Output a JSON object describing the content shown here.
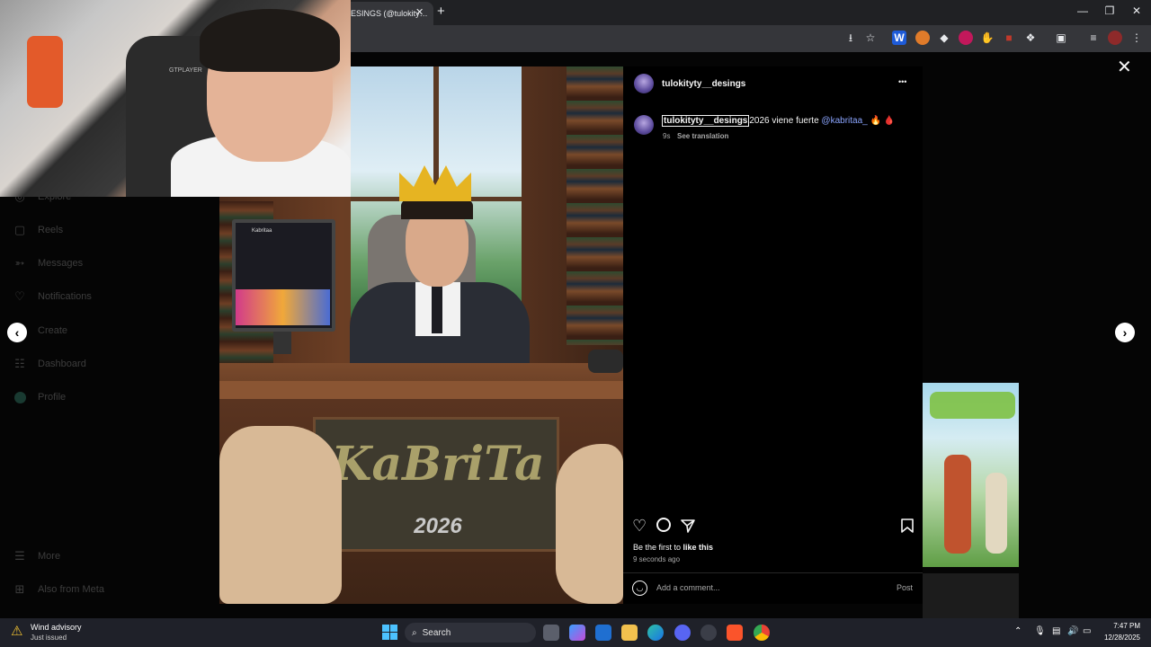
{
  "browser": {
    "tab_title": "ESINGS (@tulokity…",
    "tab_close": "✕",
    "new_tab": "+",
    "win_min": "—",
    "win_max": "❐",
    "win_close": "✕"
  },
  "sidebar": {
    "items": [
      {
        "label": "Explore",
        "icon": "compass-icon"
      },
      {
        "label": "Reels",
        "icon": "reels-icon"
      },
      {
        "label": "Messages",
        "icon": "messenger-icon"
      },
      {
        "label": "Notifications",
        "icon": "heart-icon"
      },
      {
        "label": "Create",
        "icon": "plus-icon"
      },
      {
        "label": "Dashboard",
        "icon": "chart-icon"
      },
      {
        "label": "Profile",
        "icon": "avatar-icon"
      }
    ],
    "more": "More",
    "also_from_meta": "Also from Meta"
  },
  "webcam": {
    "chair_label": "GTPLAYER"
  },
  "post_image": {
    "monitor_title": "Kabritaa",
    "logo_text": "KaBriTa",
    "year_text": "2026"
  },
  "panel": {
    "author": "tulokityty__desings",
    "more_icon": "•••",
    "caption_user": "tulokityty__desings",
    "caption_text": "2026 viene fuerte ",
    "caption_mention": "@kabritaa_",
    "caption_emoji": " 🔥 🩸",
    "time_short": "9s",
    "see_translation": "See translation",
    "likes_prefix": "Be the first to ",
    "likes_link": "like this",
    "time_long": "9 seconds ago",
    "comment_placeholder": "Add a comment...",
    "post_button": "Post"
  },
  "taskbar": {
    "weather_title": "Wind advisory",
    "weather_sub": "Just issued",
    "search_label": "Search",
    "time": "7:47 PM",
    "date": "12/28/2025"
  },
  "colors": {
    "accent_link": "#8ba5ff",
    "panel_bg": "#000000"
  }
}
